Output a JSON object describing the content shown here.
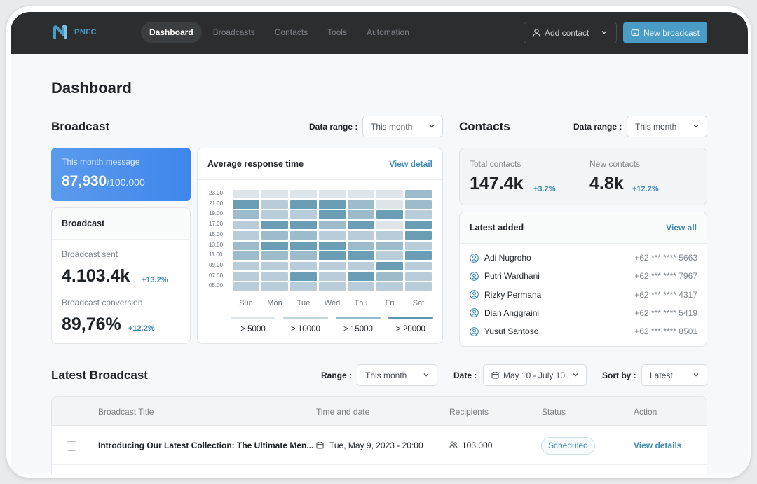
{
  "header": {
    "brand": "PNFC",
    "nav": [
      "Dashboard",
      "Broadcasts",
      "Contacts",
      "Tools",
      "Automation"
    ],
    "active_nav": "Dashboard",
    "add_contact": "Add contact",
    "new_broadcast": "New broadcast",
    "accent": "#4a9cc7"
  },
  "page_title": "Dashboard",
  "broadcast": {
    "title": "Broadcast",
    "range_label": "Data range :",
    "range_value": "This month",
    "month_message": {
      "label": "This month message",
      "value": "87,930",
      "total": "/100.000"
    },
    "card_title": "Broadcast",
    "sent_label": "Broadcast sent",
    "sent_value": "4.103.4k",
    "sent_change": "+13.2%",
    "conversion_label": "Broadcast conversion",
    "conversion_value": "89,76%",
    "conversion_change": "+12.2%"
  },
  "response_time": {
    "title": "Average response time",
    "link": "View detail",
    "y_labels": [
      "23.00",
      "21.00",
      "19.00",
      "17.00",
      "15.00",
      "13.00",
      "11.00",
      "09.00",
      "07.00",
      "05.00"
    ],
    "days": [
      "Sun",
      "Mon",
      "Tue",
      "Wed",
      "Thu",
      "Fri",
      "Sat"
    ],
    "levels": [
      [
        0,
        0,
        0,
        0,
        0,
        0,
        2
      ],
      [
        3,
        1,
        3,
        3,
        2,
        0,
        2
      ],
      [
        2,
        1,
        1,
        3,
        2,
        3,
        1
      ],
      [
        1,
        3,
        3,
        2,
        3,
        0,
        3
      ],
      [
        1,
        2,
        2,
        1,
        1,
        1,
        3
      ],
      [
        2,
        3,
        3,
        3,
        2,
        2,
        1
      ],
      [
        2,
        2,
        2,
        3,
        3,
        1,
        3
      ],
      [
        1,
        1,
        1,
        1,
        1,
        3,
        1
      ],
      [
        1,
        1,
        3,
        1,
        3,
        2,
        1
      ],
      [
        1,
        1,
        1,
        1,
        1,
        1,
        1
      ]
    ],
    "legend": [
      "> 5000",
      "> 10000",
      "> 15000",
      "> 20000"
    ],
    "legend_colors": [
      "#dfe5ea",
      "#c2d3de",
      "#98b9c9",
      "#5f92ab"
    ]
  },
  "contacts": {
    "title": "Contacts",
    "range_label": "Data range :",
    "range_value": "This month",
    "total_label": "Total contacts",
    "total_value": "147.4k",
    "total_change": "+3.2%",
    "new_label": "New contacts",
    "new_value": "4.8k",
    "new_change": "+12.2%",
    "latest_title": "Latest added",
    "view_all": "View all",
    "list": [
      {
        "name": "Adi Nugroho",
        "phone": "+62 *** **** 5663"
      },
      {
        "name": "Putri Wardhani",
        "phone": "+62 *** **** 7967"
      },
      {
        "name": "Rizky Permana",
        "phone": "+62 *** **** 4317"
      },
      {
        "name": "Dian Anggraini",
        "phone": "+62 *** **** 5419"
      },
      {
        "name": "Yusuf Santoso",
        "phone": "+62 *** **** 8501"
      }
    ]
  },
  "latest_broadcast": {
    "title": "Latest Broadcast",
    "range_label": "Range :",
    "range_value": "This month",
    "date_label": "Date :",
    "date_value": "May 10 - July 10",
    "sort_label": "Sort by :",
    "sort_value": "Latest",
    "columns": [
      "Broadcast Title",
      "Time and date",
      "Recipients",
      "Status",
      "Action"
    ],
    "rows": [
      {
        "title": "Introducing Our Latest Collection: The Ultimate Men...",
        "time": "Tue, May 9, 2023 - 20:00",
        "recipients": "103.000",
        "status": "Scheduled",
        "action": "View details"
      }
    ]
  }
}
